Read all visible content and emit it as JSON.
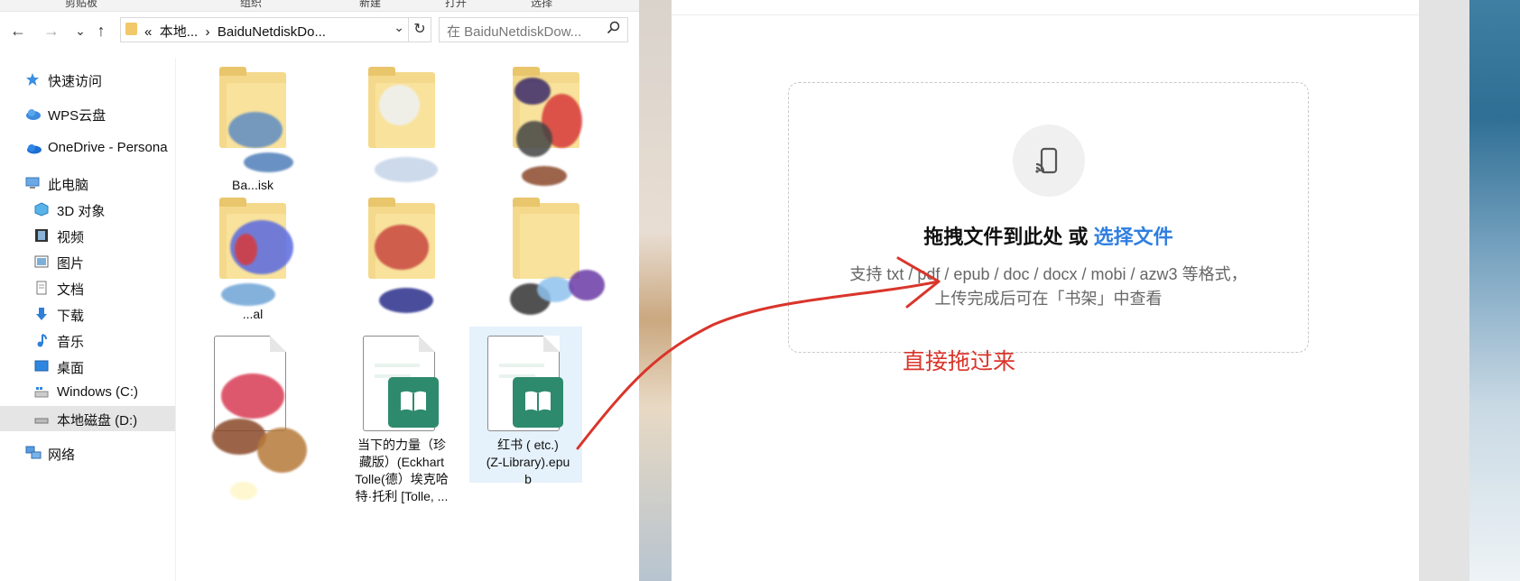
{
  "explorer": {
    "ribbon": [
      "剪贴板",
      "组织",
      "新建",
      "打开",
      "选择"
    ],
    "nav": {
      "back": "←",
      "forward": "→",
      "recent": "⌄",
      "up": "↑"
    },
    "address": {
      "prefix": "«",
      "path": [
        "本地...",
        "BaiduNetdiskDo..."
      ],
      "separator": "›",
      "dropdown": "⌄"
    },
    "refresh": "↻",
    "search": {
      "placeholder": "在 BaiduNetdiskDow...",
      "icon": "search-icon"
    },
    "sidebar": [
      {
        "label": "快速访问",
        "icon": "star-icon"
      },
      {
        "label": "WPS云盘",
        "icon": "cloud-icon"
      },
      {
        "label": "OneDrive - Persona",
        "icon": "onedrive-icon"
      },
      {
        "label": "此电脑",
        "icon": "computer-icon"
      },
      {
        "label": "3D 对象",
        "icon": "cube-icon"
      },
      {
        "label": "视频",
        "icon": "video-icon"
      },
      {
        "label": "图片",
        "icon": "picture-icon"
      },
      {
        "label": "文档",
        "icon": "document-icon"
      },
      {
        "label": "下载",
        "icon": "download-icon"
      },
      {
        "label": "音乐",
        "icon": "music-icon"
      },
      {
        "label": "桌面",
        "icon": "desktop-icon"
      },
      {
        "label": "Windows (C:)",
        "icon": "drive-icon"
      },
      {
        "label": "本地磁盘 (D:)",
        "icon": "drive-icon",
        "selected": true
      },
      {
        "label": "网络",
        "icon": "network-icon"
      }
    ],
    "files": [
      {
        "label": "Ba...isk",
        "type": "folder"
      },
      {
        "label": "",
        "type": "folder"
      },
      {
        "label": "",
        "type": "folder"
      },
      {
        "label": "...al",
        "type": "folder"
      },
      {
        "label": "",
        "type": "folder"
      },
      {
        "label": "",
        "type": "folder"
      },
      {
        "label": "",
        "type": "document"
      },
      {
        "label_lines": [
          "当下的力量（珍",
          "藏版）(Eckhart",
          "Tolle(德）埃克哈",
          "特·托利 [Tolle, ..."
        ],
        "type": "epub"
      },
      {
        "label_lines": [
          "红书 ( etc.)",
          "(Z-Library).epu",
          "b"
        ],
        "type": "epub",
        "selected": true
      }
    ]
  },
  "upload": {
    "icon": "cast-icon",
    "title_main": "拖拽文件到此处 或 ",
    "title_link": "选择文件",
    "desc_line1": "支持 txt / pdf / epub / doc / docx / mobi / azw3 等格式，",
    "desc_line2": "上传完成后可在「书架」中查看",
    "annotation": "直接拖过来",
    "accent": "#2f7fe0",
    "annotation_color": "#d9352b"
  }
}
